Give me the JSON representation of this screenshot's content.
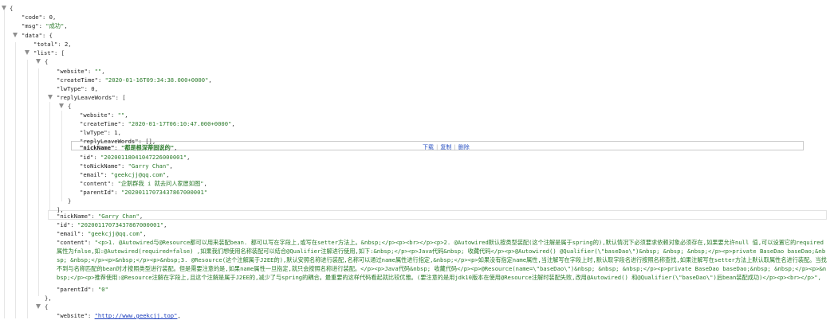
{
  "lines": {
    "l1": "{",
    "code_k": "\"code\"",
    "code_v": "0",
    "msg_k": "\"msg\"",
    "msg_v": "\"成功\"",
    "data_k": "\"data\"",
    "data_o": "{",
    "total_k": "\"total\"",
    "total_v": "2",
    "list_k": "\"list\"",
    "list_o": "[",
    "item_o": "{",
    "website_k": "\"website\"",
    "website_v": "\"\"",
    "ctime_k": "\"createTime\"",
    "ctime_v": "\"2020-01-16T09:34:38.000+0000\"",
    "lwtype_k": "\"lwType\"",
    "lwtype_v": "0",
    "reply_k": "\"replyLeaveWords\"",
    "reply_o": "[",
    "sub_o": "{",
    "s_website_k": "\"website\"",
    "s_website_v": "\"\"",
    "s_ctime_k": "\"createTime\"",
    "s_ctime_v": "\"2020-01-17T06:10:47.000+0000\"",
    "s_lwtype_k": "\"lwType\"",
    "s_lwtype_v": "1",
    "s_reply_k": "\"replyLeaveWords\"",
    "s_reply_v": "[]",
    "s_nick_k": "\"nickName\"",
    "s_nick_v": "\"都是根深蒂固说的\"",
    "s_id_k": "\"id\"",
    "s_id_v": "\"20200118041047226000001\"",
    "s_tonick_k": "\"toNickName\"",
    "s_tonick_v": "\"Garry Chan\"",
    "s_email_k": "\"email\"",
    "s_email_v": "\"geekcjj@qq.com\"",
    "s_content_k": "\"content\"",
    "s_content_v": "\"企鹅群我 i 就去问人家愿如图\"",
    "s_parent_k": "\"parentId\"",
    "s_parent_v": "\"20200117073437867000001\"",
    "sub_c": "}",
    "reply_c": "],",
    "nick_k": "\"nickName\"",
    "nick_v": "\"Garry Chan\"",
    "id_k": "\"id\"",
    "id_v": "\"20200117073437867000001\"",
    "email_k": "\"email\"",
    "email_v": "\"geekcjj@qq.com\"",
    "content_k": "\"content\"",
    "content_v": "\"<p>1. @Autowired与@Resource都可以用来装配bean. 都可以写在字段上,或写在setter方法上。&nbsp;</p><p><br></p><p>2. @Autowired默认按类型装配(这个注解是属于spring的),默认情况下必须要求依赖对象必须存在,如果要允许null 值,可以设置它的required属性为false,如:@Autowired(required=false) ,如果我们想使用名称装配可以结合@Qualifier注解进行使用,如下:&nbsp;</p><p>Java代码&nbsp; 收藏代码</p><p>@Autowired() @Qualifier(\\\"baseDao\\\")&nbsp; &nbsp; &nbsp;</p><p>private BaseDao baseDao;&nbsp; &nbsp;</p><p>&nbsp;</p><p>&nbsp;3. @Resource(这个注解属于J2EE的),默认安照名称进行装配,名称可以通过name属性进行指定,&nbsp;</p><p>如果没有指定name属性,当注解写在字段上时,默认取字段名进行按照名称查找,如果注解写在setter方法上默认取属性名进行装配。当找不到与名称匹配的bean时才按照类型进行装配。但是需要注意的是,如果name属性一旦指定,就只会按照名称进行装配。</p><p>Java代码&nbsp; 收藏代码</p><p>@Resource(name=\\\"baseDao\\\")&nbsp; &nbsp; &nbsp;</p><p>private BaseDao baseDao;&nbsp; &nbsp;</p><p>&nbsp;</p><p>推荐使用:@Resource注解在字段上,且这个注解是属于J2EE的,减少了与spring的耦合。最重要的这样代码看起就比较优雅。(要注意的是用jdk10版本在使用@Resource注解时装配失败,改用@Autowired() 和@Qualifier(\\\"baseDao\\\")后bean装配成功)</p><p><br></p>\",",
    "parent_k": "\"parentId\"",
    "parent_v": "\"0\"",
    "item_c": "},",
    "item2_o": "{",
    "w2_k": "\"website\"",
    "w2_v": "\"http://www.geekcjj.top\""
  },
  "actions": {
    "download": "下载",
    "copy": "复制",
    "delete": "删除"
  },
  "icons": {
    "toggle": "collapse-triangle-icon"
  }
}
